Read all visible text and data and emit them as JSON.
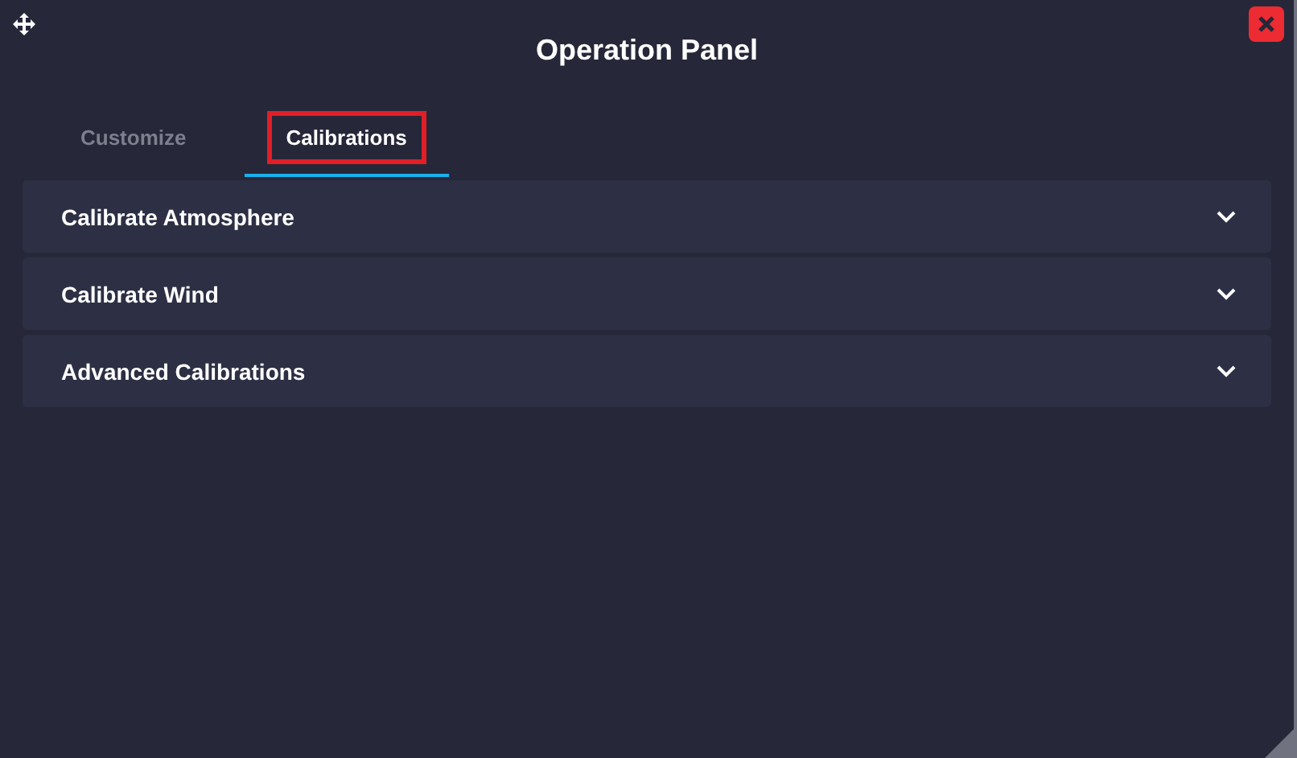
{
  "window": {
    "title": "Operation Panel"
  },
  "tabs": [
    {
      "label": "Customize",
      "selected": false,
      "highlighted": false
    },
    {
      "label": "Calibrations",
      "selected": true,
      "highlighted": true
    }
  ],
  "sections": [
    {
      "label": "Calibrate Atmosphere",
      "expanded": false
    },
    {
      "label": "Calibrate Wind",
      "expanded": false
    },
    {
      "label": "Advanced Calibrations",
      "expanded": false
    }
  ]
}
